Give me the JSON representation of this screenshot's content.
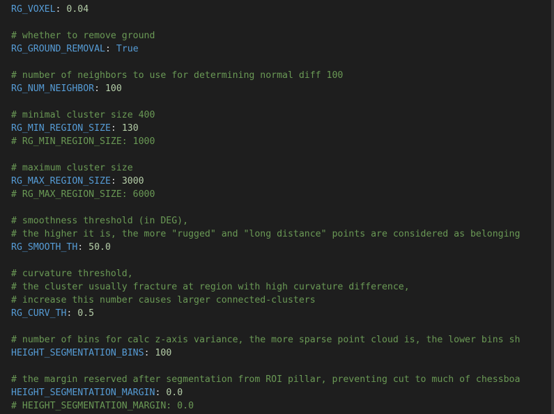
{
  "editor": {
    "lines": [
      {
        "type": "kv",
        "key": "RG_VOXEL",
        "value": "0.04",
        "vtype": "num"
      },
      {
        "type": "blank"
      },
      {
        "type": "comment",
        "text": "# whether to remove ground"
      },
      {
        "type": "kv",
        "key": "RG_GROUND_REMOVAL",
        "value": "True",
        "vtype": "bool"
      },
      {
        "type": "blank"
      },
      {
        "type": "comment",
        "text": "# number of neighbors to use for determining normal diff 100"
      },
      {
        "type": "kv",
        "key": "RG_NUM_NEIGHBOR",
        "value": "100",
        "vtype": "num"
      },
      {
        "type": "blank"
      },
      {
        "type": "comment",
        "text": "# minimal cluster size 400"
      },
      {
        "type": "kv",
        "key": "RG_MIN_REGION_SIZE",
        "value": "130",
        "vtype": "num"
      },
      {
        "type": "comment",
        "text": "# RG_MIN_REGION_SIZE: 1000"
      },
      {
        "type": "blank"
      },
      {
        "type": "comment",
        "text": "# maximum cluster size"
      },
      {
        "type": "kv",
        "key": "RG_MAX_REGION_SIZE",
        "value": "3000",
        "vtype": "num"
      },
      {
        "type": "comment",
        "text": "# RG_MAX_REGION_SIZE: 6000"
      },
      {
        "type": "blank"
      },
      {
        "type": "comment",
        "text": "# smoothness threshold (in DEG),"
      },
      {
        "type": "comment",
        "text": "# the higher it is, the more \"rugged\" and \"long distance\" points are considered as belonging"
      },
      {
        "type": "kv",
        "key": "RG_SMOOTH_TH",
        "value": "50.0",
        "vtype": "num"
      },
      {
        "type": "blank"
      },
      {
        "type": "comment",
        "text": "# curvature threshold,"
      },
      {
        "type": "comment",
        "text": "# the cluster usually fracture at region with high curvature difference,"
      },
      {
        "type": "comment",
        "text": "# increase this number causes larger connected-clusters"
      },
      {
        "type": "kv",
        "key": "RG_CURV_TH",
        "value": "0.5",
        "vtype": "num"
      },
      {
        "type": "blank"
      },
      {
        "type": "comment",
        "text": "# number of bins for calc z-axis variance, the more sparse point cloud is, the lower bins sh"
      },
      {
        "type": "kv",
        "key": "HEIGHT_SEGMENTATION_BINS",
        "value": "100",
        "vtype": "num"
      },
      {
        "type": "blank"
      },
      {
        "type": "comment",
        "text": "# the margin reserved after segmentation from ROI pillar, preventing cut to much of chessboa"
      },
      {
        "type": "kv",
        "key": "HEIGHT_SEGMENTATION_MARGIN",
        "value": "0.0",
        "vtype": "num"
      },
      {
        "type": "comment",
        "text": "# HEIGHT_SEGMENTATION_MARGIN: 0.0"
      }
    ],
    "colors": {
      "background": "#1e1e1e",
      "comment": "#6a9955",
      "key": "#569cd6",
      "number": "#b5cea8",
      "text": "#d4d4d4"
    }
  }
}
